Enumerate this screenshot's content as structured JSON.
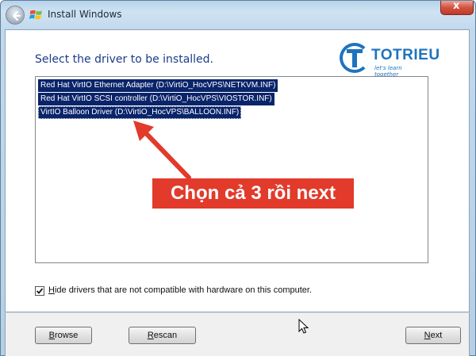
{
  "window": {
    "title": "Install Windows",
    "close_glyph": "x"
  },
  "main": {
    "heading": "Select the driver to be installed.",
    "drivers": [
      {
        "label": "Red Hat VirtIO Ethernet Adapter (D:\\VirtiO_HocVPS\\NETKVM.INF)",
        "selected": true
      },
      {
        "label": "Red Hat VirtIO SCSI controller (D:\\VirtiO_HocVPS\\VIOSTOR.INF)",
        "selected": true
      },
      {
        "label": "VirtIO Balloon Driver (D:\\VirtiO_HocVPS\\BALLOON.INF)",
        "selected": true
      }
    ],
    "annotation": "Chọn cả 3 rồi next",
    "hide_incompatible": {
      "checked": true,
      "mnemonic": "H",
      "label_rest": "ide drivers that are not compatible with hardware on this computer."
    }
  },
  "logo": {
    "name": "TOTRIEU",
    "tagline": "let's learn together"
  },
  "footer": {
    "browse": {
      "mnemonic": "B",
      "rest": "rowse"
    },
    "rescan": {
      "mnemonic": "R",
      "rest": "escan"
    },
    "next": {
      "mnemonic": "N",
      "rest": "ext"
    }
  },
  "colors": {
    "selection": "#0a246a",
    "annotation_bg": "#e23a2b",
    "heading": "#1e3a8a",
    "logo": "#1e73be"
  }
}
